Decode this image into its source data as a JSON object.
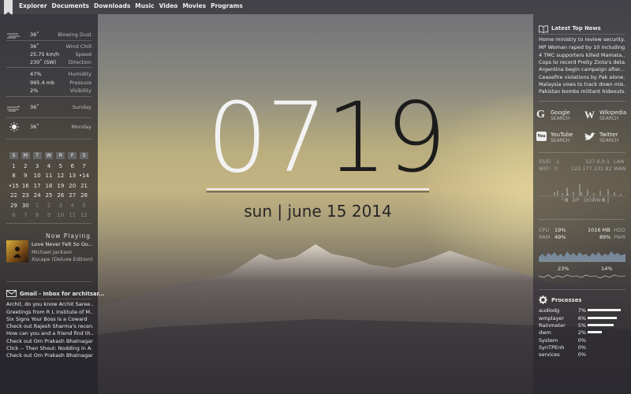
{
  "menu": [
    "Explorer",
    "Documents",
    "Downloads",
    "Music",
    "Video",
    "Movies",
    "Programs"
  ],
  "weather": {
    "now_temp": "36˚",
    "now_cond": "Blowing Dust",
    "wind_chill_val": "36˚",
    "wind_chill_label": "Wind Chill",
    "speed_val": "25.75 km/h",
    "speed_label": "Speed",
    "direction_val": "230˚ (SW)",
    "direction_label": "Direction",
    "humidity_val": "47%",
    "humidity_label": "Humidity",
    "pressure_val": "995.4 mb",
    "pressure_label": "Pressure",
    "visibility_val": "2%",
    "visibility_label": "Visibility",
    "day1_temp": "36˚",
    "day1_name": "Sunday",
    "day2_temp": "36˚",
    "day2_name": "Monday"
  },
  "calendar": {
    "headers": [
      "S",
      "M",
      "T",
      "W",
      "R",
      "F",
      "S"
    ],
    "rows": [
      [
        "1",
        "2",
        "3",
        "4",
        "5",
        "6",
        "7"
      ],
      [
        "8",
        "9",
        "10",
        "11",
        "12",
        "13",
        "•14"
      ],
      [
        "•15",
        "16",
        "17",
        "18",
        "19",
        "20",
        "21"
      ],
      [
        "22",
        "23",
        "24",
        "25",
        "26",
        "27",
        "28"
      ],
      [
        "29",
        "30",
        "1",
        "2",
        "3",
        "4",
        "5"
      ],
      [
        "6",
        "7",
        "8",
        "9",
        "10",
        "11",
        "12"
      ]
    ]
  },
  "now_playing": {
    "header": "Now Playing",
    "title": "Love Never Felt So Go...",
    "artist": "Michael Jackson",
    "album": "Xscape (Deluxe Edition)"
  },
  "gmail": {
    "header": "Gmail - Inbox for architsar...",
    "items": [
      "Archit, do you know Archit Saree...",
      "Greetings from R L Institute of M...",
      "Six Signs Your Boss Is a Coward",
      "Check out Rajesh Sharma's recen...",
      "How can you and a friend find th...",
      "Check out Om Prakash Bhatnagar...",
      "Click -- Then Shout: Nodding in A...",
      "Check out Om Prakash Bhatnagar..."
    ]
  },
  "clock": {
    "hh": "07",
    "mm": "19",
    "date": "sun | june 15 2014"
  },
  "news": {
    "header": "Latest Top News",
    "items": [
      "Home ministry to review security...",
      "MP Woman raped by 10 including...",
      "4 TMC supporters killed Mamata...",
      "Cops to record Preity Zinta's deta...",
      "Argentina begin campaign after...",
      "Ceasefire violations by Pak alone...",
      "Malaysia vows to track down mis...",
      "Pakistan bombs militant hideouts..."
    ]
  },
  "search": {
    "google": "Google",
    "wikipedia": "Wikipedia",
    "youtube": "YouTube",
    "twitter": "Twitter",
    "sub": "SEARCH"
  },
  "network": {
    "ssid_label": "SSID",
    "ssid_val": "-1",
    "lan_ip": "127.0.0.1",
    "lan_label": "LAN",
    "wifi_label": "WIFI",
    "wifi_val": "0",
    "wan_ip": "122.177.231.82",
    "wan_label": "WAN",
    "up_val": "0",
    "up_label": "UP",
    "down_label": "DOWN",
    "down_val": "0"
  },
  "system": {
    "cpu_label": "CPU",
    "cpu_val": "19%",
    "hdd_val": "1016 MB",
    "hdd_label": "HDD",
    "ram_label": "RAM",
    "ram_val": "49%",
    "pwr_val": "89%",
    "pwr_label": "PWR",
    "c1": "23%",
    "c2": "14%"
  },
  "processes": {
    "header": "Processes",
    "items": [
      {
        "name": "audiodg",
        "pct": "7%",
        "level": 0.92
      },
      {
        "name": "wmplayer",
        "pct": "6%",
        "level": 0.8
      },
      {
        "name": "Rainmeter",
        "pct": "5%",
        "level": 0.72
      },
      {
        "name": "dwm",
        "pct": "2%",
        "level": 0.4
      },
      {
        "name": "System",
        "pct": "0%",
        "level": 0.0
      },
      {
        "name": "SynTPEnh",
        "pct": "0%",
        "level": 0.0
      },
      {
        "name": "services",
        "pct": "0%",
        "level": 0.0
      }
    ]
  }
}
